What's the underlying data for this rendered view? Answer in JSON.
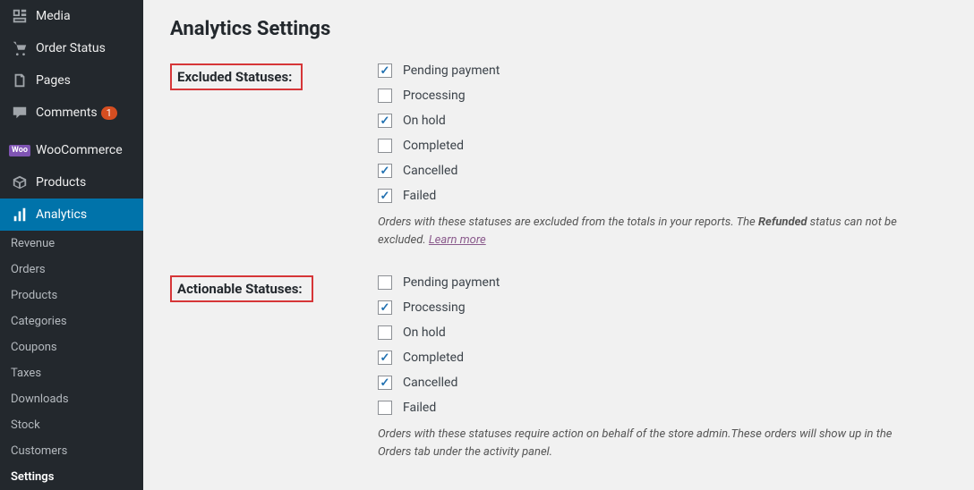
{
  "sidebar": {
    "main_items": [
      {
        "label": "Media",
        "icon": "media"
      },
      {
        "label": "Order Status",
        "icon": "cart"
      },
      {
        "label": "Pages",
        "icon": "pages"
      },
      {
        "label": "Comments",
        "icon": "comments",
        "badge": "1"
      }
    ],
    "woo_items": [
      {
        "label": "WooCommerce",
        "icon": "woo"
      },
      {
        "label": "Products",
        "icon": "products"
      },
      {
        "label": "Analytics",
        "icon": "analytics",
        "active": true
      }
    ],
    "sub_items": [
      {
        "label": "Revenue"
      },
      {
        "label": "Orders"
      },
      {
        "label": "Products"
      },
      {
        "label": "Categories"
      },
      {
        "label": "Coupons"
      },
      {
        "label": "Taxes"
      },
      {
        "label": "Downloads"
      },
      {
        "label": "Stock"
      },
      {
        "label": "Customers"
      },
      {
        "label": "Settings",
        "current": true
      }
    ]
  },
  "main": {
    "title": "Analytics Settings",
    "sections": [
      {
        "label": "Excluded Statuses:",
        "checkboxes": [
          {
            "label": "Pending payment",
            "checked": true
          },
          {
            "label": "Processing",
            "checked": false
          },
          {
            "label": "On hold",
            "checked": true
          },
          {
            "label": "Completed",
            "checked": false
          },
          {
            "label": "Cancelled",
            "checked": true
          },
          {
            "label": "Failed",
            "checked": true
          }
        ],
        "desc_before": "Orders with these statuses are excluded from the totals in your reports. The ",
        "desc_bold": "Refunded",
        "desc_after": " status can not be excluded. ",
        "link": "Learn more"
      },
      {
        "label": "Actionable Statuses:",
        "checkboxes": [
          {
            "label": "Pending payment",
            "checked": false
          },
          {
            "label": "Processing",
            "checked": true
          },
          {
            "label": "On hold",
            "checked": false
          },
          {
            "label": "Completed",
            "checked": true
          },
          {
            "label": "Cancelled",
            "checked": true
          },
          {
            "label": "Failed",
            "checked": false
          }
        ],
        "desc_before": "Orders with these statuses require action on behalf of the store admin.These orders will show up in the Orders tab under the activity panel.",
        "desc_bold": "",
        "desc_after": "",
        "link": ""
      }
    ]
  }
}
